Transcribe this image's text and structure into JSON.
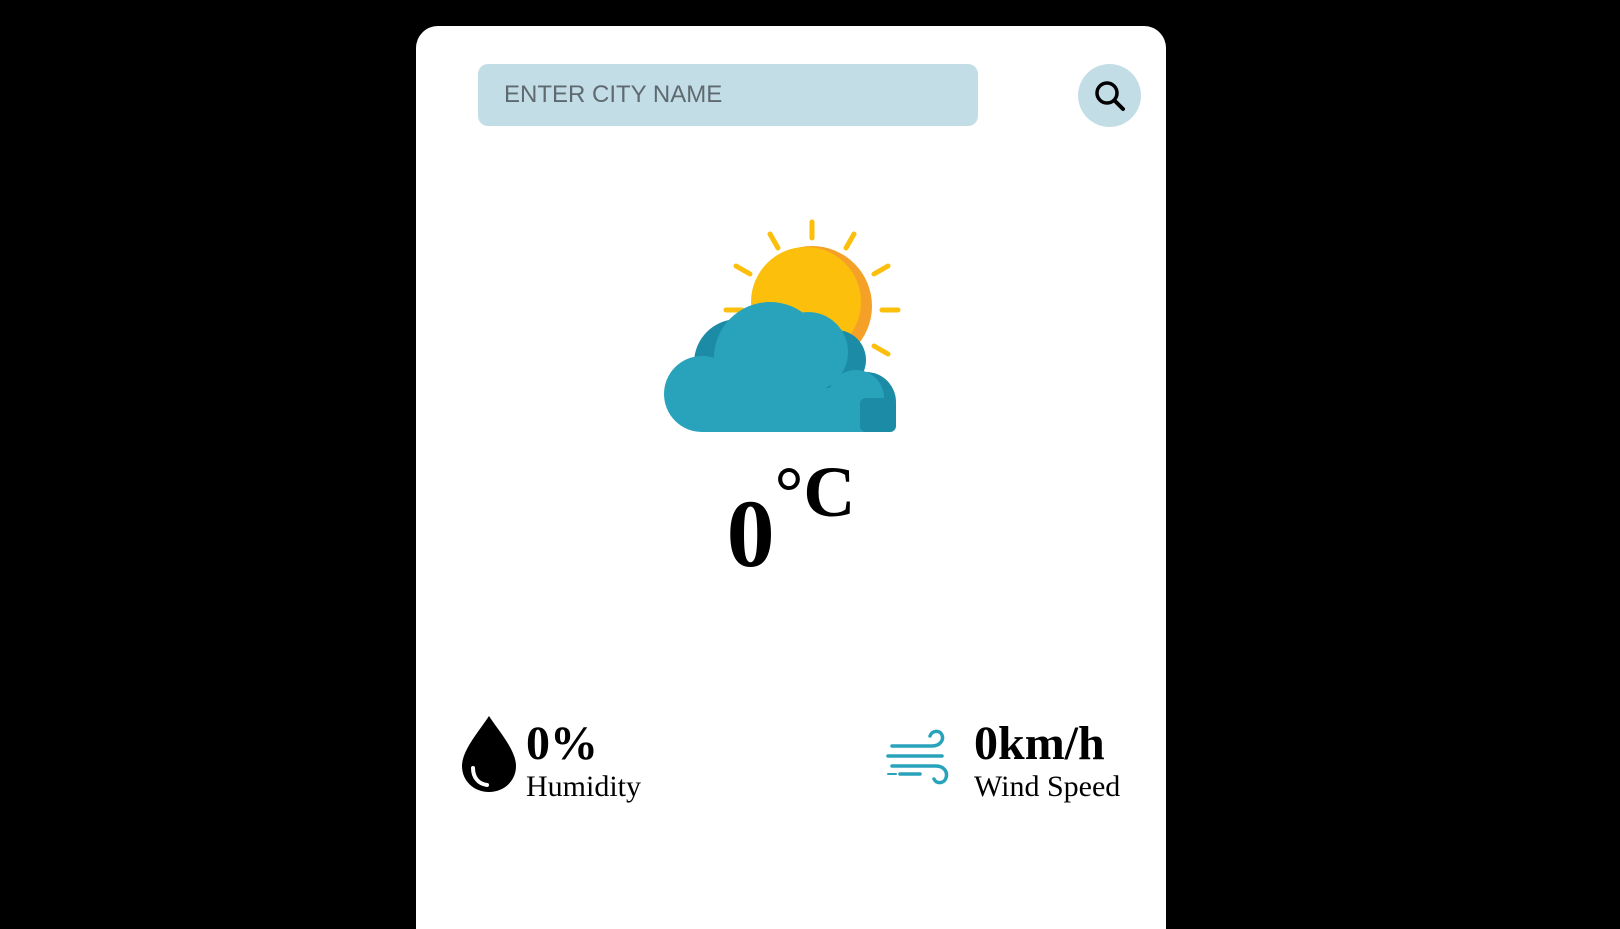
{
  "search": {
    "placeholder": "ENTER CITY NAME",
    "value": "",
    "button_icon": "search-icon"
  },
  "weather": {
    "icon": "partly-cloudy-icon",
    "temperature_value": "0",
    "temperature_unit": "°C"
  },
  "humidity": {
    "icon": "water-drop-icon",
    "value": "0%",
    "label": "Humidity"
  },
  "wind": {
    "icon": "wind-icon",
    "value": "0km/h",
    "label": "Wind Speed"
  },
  "colors": {
    "background": "#000000",
    "card": "#ffffff",
    "input_bg": "#c3dde7",
    "sun": "#fbbf0c",
    "sun_shade": "#f5a127",
    "cloud": "#29a3bb",
    "cloud_shade": "#1c8ca6"
  }
}
